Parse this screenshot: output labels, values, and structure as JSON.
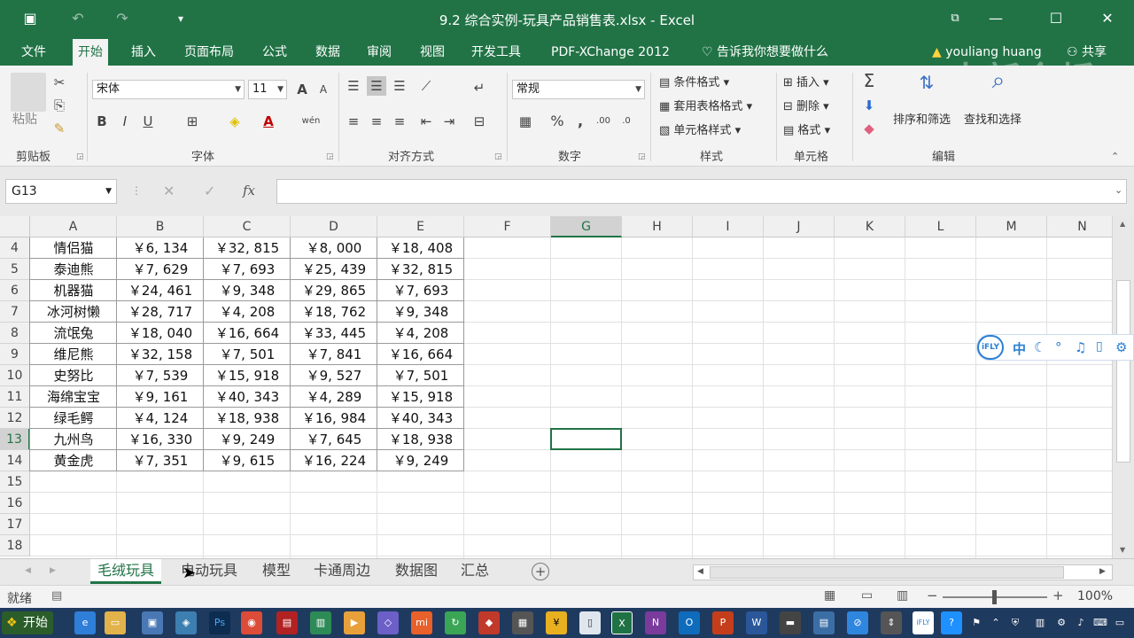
{
  "window": {
    "title": "9.2 综合实例-玩具产品销售表.xlsx - Excel",
    "watermark": "中新金桥"
  },
  "ribbon_tabs": [
    "文件",
    "开始",
    "插入",
    "页面布局",
    "公式",
    "数据",
    "审阅",
    "视图",
    "开发工具",
    "PDF-XChange 2012"
  ],
  "active_tab": "开始",
  "tell_me": "告诉我你想要做什么",
  "user": {
    "name": "youliang huang",
    "share": "共享"
  },
  "ribbon": {
    "clipboard": {
      "paste": "粘贴",
      "label": "剪贴板"
    },
    "font": {
      "name": "宋体",
      "size": "11",
      "bold": "B",
      "italic": "I",
      "underline": "U",
      "grow": "A",
      "shrink": "A",
      "font_color": "A",
      "phonetic": "wén",
      "label": "字体"
    },
    "alignment": {
      "label": "对齐方式"
    },
    "number": {
      "format": "常规",
      "percent": "%",
      "comma": ",",
      "label": "数字"
    },
    "styles": {
      "conditional": "条件格式",
      "table": "套用表格格式",
      "cell_styles": "单元格样式",
      "label": "样式"
    },
    "cells": {
      "insert": "插入",
      "delete": "删除",
      "format": "格式",
      "label": "单元格"
    },
    "editing": {
      "sort": "排序和筛选",
      "find": "查找和选择",
      "label": "编辑"
    }
  },
  "formula_bar": {
    "name_box": "G13",
    "fx": "fx",
    "formula": ""
  },
  "columns": [
    "A",
    "B",
    "C",
    "D",
    "E",
    "F",
    "G",
    "H",
    "I",
    "J",
    "K",
    "L",
    "M",
    "N"
  ],
  "selected_column": "G",
  "selected_row": "13",
  "rows": [
    {
      "num": "4",
      "cells": [
        "情侣猫",
        "￥6, 134",
        "￥32, 815",
        "￥8, 000",
        "￥18, 408"
      ]
    },
    {
      "num": "5",
      "cells": [
        "泰迪熊",
        "￥7, 629",
        "￥7, 693",
        "￥25, 439",
        "￥32, 815"
      ]
    },
    {
      "num": "6",
      "cells": [
        "机器猫",
        "￥24, 461",
        "￥9, 348",
        "￥29, 865",
        "￥7, 693"
      ]
    },
    {
      "num": "7",
      "cells": [
        "冰河树懒",
        "￥28, 717",
        "￥4, 208",
        "￥18, 762",
        "￥9, 348"
      ]
    },
    {
      "num": "8",
      "cells": [
        "流氓兔",
        "￥18, 040",
        "￥16, 664",
        "￥33, 445",
        "￥4, 208"
      ]
    },
    {
      "num": "9",
      "cells": [
        "维尼熊",
        "￥32, 158",
        "￥7, 501",
        "￥7, 841",
        "￥16, 664"
      ]
    },
    {
      "num": "10",
      "cells": [
        "史努比",
        "￥7, 539",
        "￥15, 918",
        "￥9, 527",
        "￥7, 501"
      ]
    },
    {
      "num": "11",
      "cells": [
        "海绵宝宝",
        "￥9, 161",
        "￥40, 343",
        "￥4, 289",
        "￥15, 918"
      ]
    },
    {
      "num": "12",
      "cells": [
        "绿毛鳄",
        "￥4, 124",
        "￥18, 938",
        "￥16, 984",
        "￥40, 343"
      ]
    },
    {
      "num": "13",
      "cells": [
        "九州鸟",
        "￥16, 330",
        "￥9, 249",
        "￥7, 645",
        "￥18, 938"
      ]
    },
    {
      "num": "14",
      "cells": [
        "黄金虎",
        "￥7, 351",
        "￥9, 615",
        "￥16, 224",
        "￥9, 249"
      ]
    },
    {
      "num": "15",
      "cells": [
        "",
        "",
        "",
        "",
        ""
      ]
    },
    {
      "num": "16",
      "cells": [
        "",
        "",
        "",
        "",
        ""
      ]
    },
    {
      "num": "17",
      "cells": [
        "",
        "",
        "",
        "",
        ""
      ]
    },
    {
      "num": "18",
      "cells": [
        "",
        "",
        "",
        "",
        ""
      ]
    }
  ],
  "sheets": [
    "毛绒玩具",
    "电动玩具",
    "模型",
    "卡通周边",
    "数据图",
    "汇总"
  ],
  "active_sheet": "毛绒玩具",
  "status": {
    "ready": "就绪",
    "zoom": "100%"
  },
  "ifly": {
    "logo": "iFLY",
    "lang": "中"
  },
  "taskbar": {
    "start": "开始"
  },
  "colors": {
    "accent": "#217346",
    "taskbar": "#1f3a5f"
  }
}
